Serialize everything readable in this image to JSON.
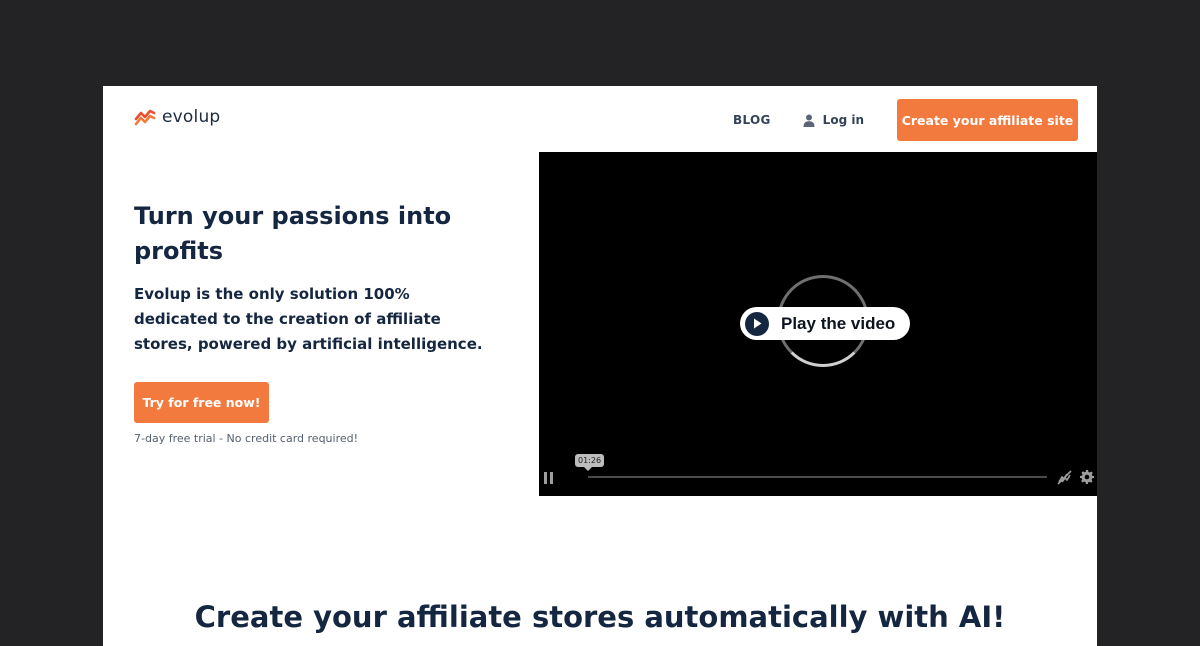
{
  "header": {
    "logo_text": "evolup",
    "logo_icon": "evolup-logo-icon",
    "nav": {
      "blog": "BLOG",
      "login": "Log in",
      "create_site": "Create your affiliate site"
    }
  },
  "hero": {
    "title": "Turn your passions into profits",
    "description": "Evolup is the only solution 100% dedicated to the creation of affiliate stores, powered by artificial intelligence.",
    "cta": "Try for free now!",
    "note": "7-day free trial - No credit card required!"
  },
  "video": {
    "play_label": "Play the video",
    "time": "01:26"
  },
  "section": {
    "heading": "Create your affiliate stores automatically with AI!"
  },
  "colors": {
    "accent": "#f37a3f",
    "navy": "#142640",
    "backdrop": "#232326"
  }
}
